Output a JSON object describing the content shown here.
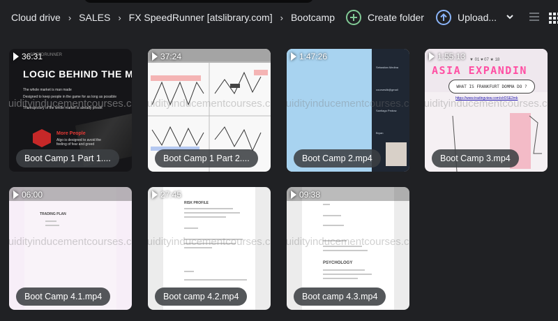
{
  "breadcrumb": [
    "Cloud drive",
    "SALES",
    "FX SpeedRunner [atslibrary.com]",
    "Bootcamp"
  ],
  "breadcrumb_separator": "›",
  "actions": {
    "create_folder": "Create folder",
    "upload": "Upload...",
    "accent_create": "#81c995",
    "accent_upload": "#8ab4f8"
  },
  "view_modes": {
    "list_icon": "list-icon",
    "grid_icon": "grid-icon",
    "active": "grid"
  },
  "watermark": "liquidityinducementcourses.com",
  "files": [
    {
      "name": "Boot Camp 1 Part 1....",
      "duration": "36:31",
      "thumb": {
        "heading": "LOGIC BEHIND THE M",
        "brand": "SPEEDRUNNER",
        "lines": [
          "The whole market is man made",
          "Designed to keep people in the game for as long as possible",
          "The trajectory of the whole market is already preset"
        ],
        "more": "More People",
        "more_sub": "Algo is designed to avoid the feeling of fear and greed"
      }
    },
    {
      "name": "Boot Camp 1 Part 2....",
      "duration": "37:24"
    },
    {
      "name": "Boot Camp 2.mp4",
      "duration": "1:47:26",
      "thumb": {
        "sidebar": [
          "Sebastian Medina",
          "courseslib@gmail",
          "Santiago Pedraz",
          "Bryan"
        ]
      }
    },
    {
      "name": "Boot Camp 3.mp4",
      "duration": "1:55:13",
      "thumb": {
        "heading": "ASIA EXPANDIN",
        "question": "WHAT IS FRANKFURT DOMMA DO ?",
        "link": "https://www.tradingview.com/x/rDSE2mk",
        "values": "▼ 01   ♥ 07   ★ 18"
      }
    },
    {
      "name": "Boot Camp 4.1.mp4",
      "duration": "06:00",
      "thumb": {
        "title": "TRADING PLAN"
      }
    },
    {
      "name": "Boot camp 4.2.mp4",
      "duration": "27:45",
      "thumb": {
        "title": "RISK PROFILE"
      }
    },
    {
      "name": "Boot camp 4.3.mp4",
      "duration": "09:38",
      "thumb": {
        "title": "PSYCHOLOGY"
      }
    }
  ]
}
